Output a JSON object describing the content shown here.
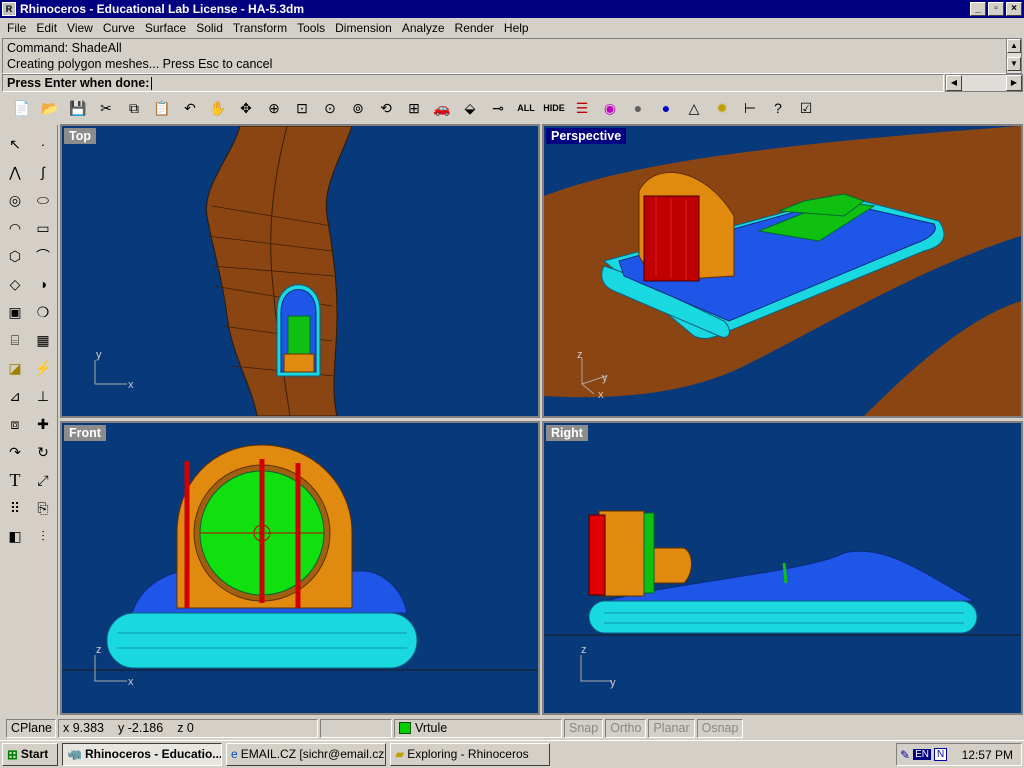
{
  "window": {
    "title": "Rhinoceros - Educational Lab License - HA-5.3dm"
  },
  "menu": [
    "File",
    "Edit",
    "View",
    "Curve",
    "Surface",
    "Solid",
    "Transform",
    "Tools",
    "Dimension",
    "Analyze",
    "Render",
    "Help"
  ],
  "command": {
    "line1": "Command: ShadeAll",
    "line2": "Creating polygon meshes... Press Esc to cancel",
    "prompt": "Press Enter when done:"
  },
  "toolbar": {
    "all_label": "ALL",
    "hide_label": "HIDE"
  },
  "viewports": {
    "top": "Top",
    "perspective": "Perspective",
    "front": "Front",
    "right": "Right"
  },
  "axes": {
    "x": "x",
    "y": "y",
    "z": "z"
  },
  "status": {
    "cplane": "CPlane",
    "x": "x 9.383",
    "y": "y -2.186",
    "z": "z 0",
    "layer": "Vrtule",
    "snap": "Snap",
    "ortho": "Ortho",
    "planar": "Planar",
    "osnap": "Osnap",
    "layer_color": "#00d000"
  },
  "taskbar": {
    "start": "Start",
    "tasks": [
      "Rhinoceros - Educatio...",
      "EMAIL.CZ [sichr@email.cz...",
      "Exploring - Rhinoceros"
    ],
    "lang": "EN",
    "clock": "12:57 PM"
  },
  "colors": {
    "viewport_bg": "#08397a",
    "ground": "#8b4513",
    "hull": "#1e56e8",
    "skirt": "#1ad8e0",
    "duct": "#e08a10",
    "prop": "#10e010",
    "rudders": "#e01010",
    "title_bar": "#000080"
  }
}
